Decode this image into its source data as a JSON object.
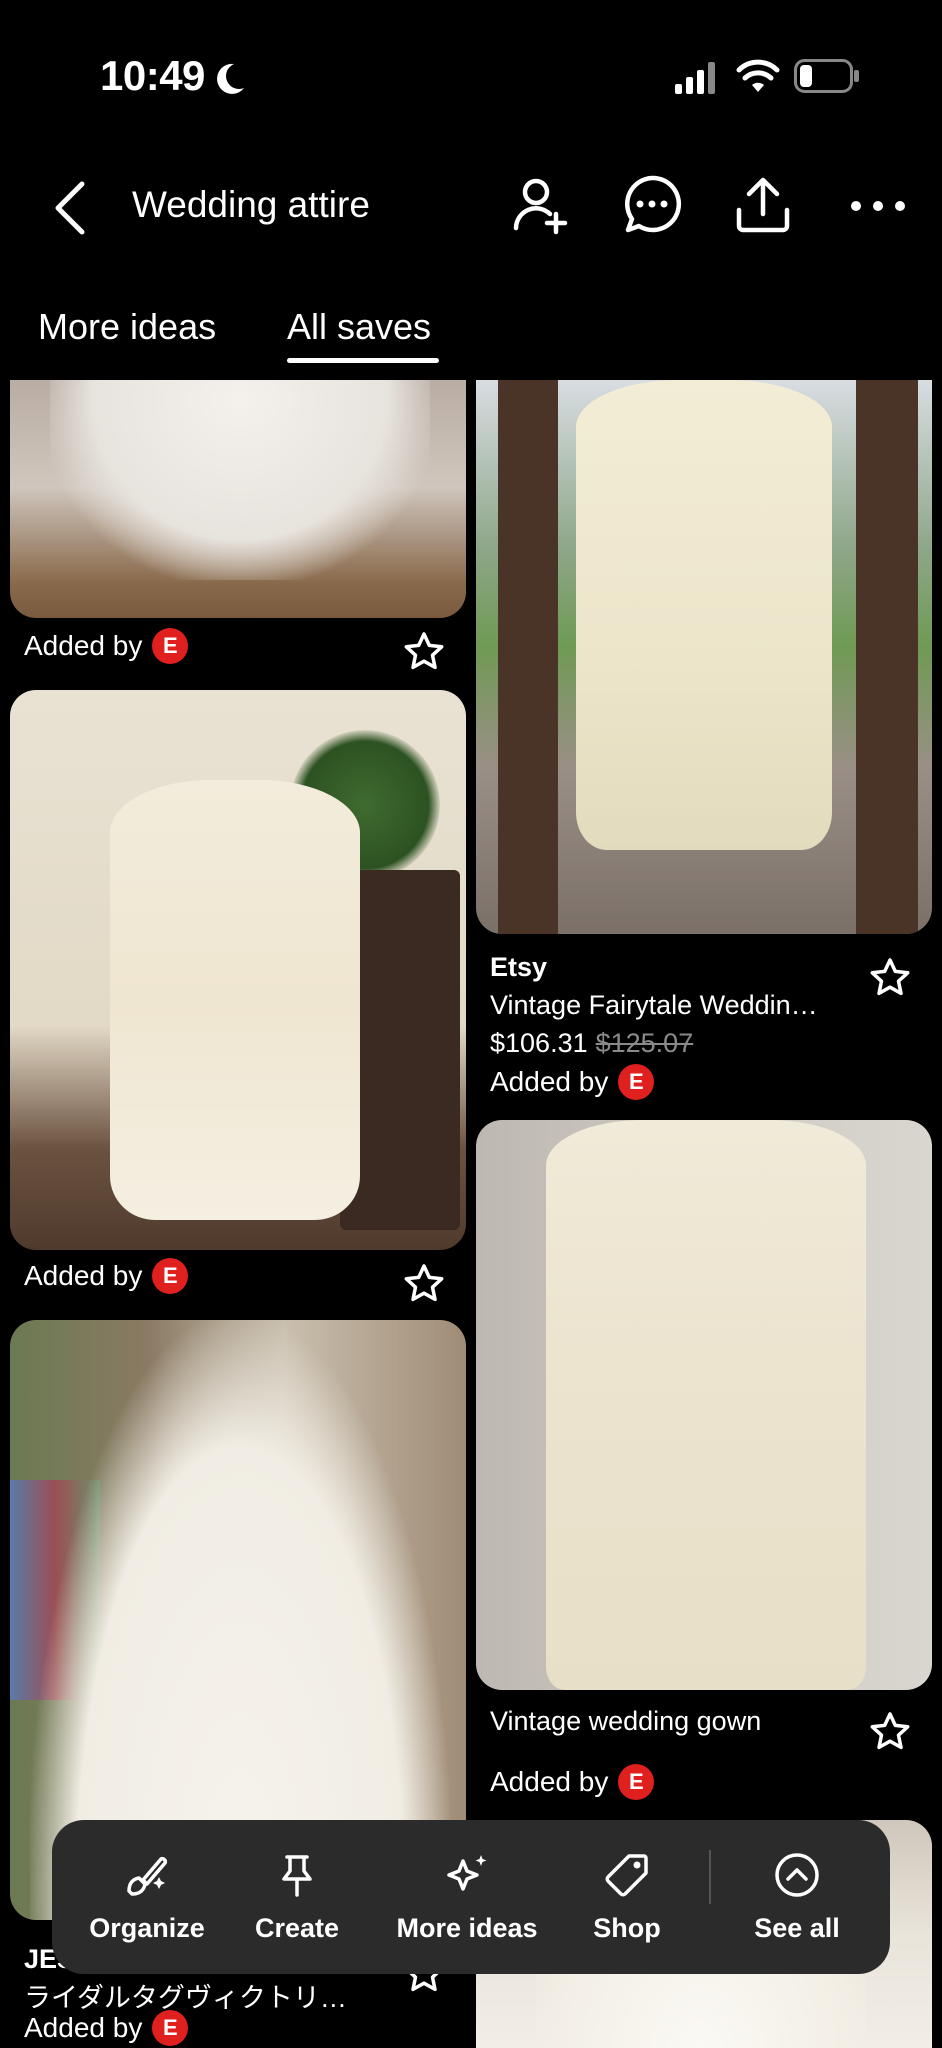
{
  "status_bar": {
    "time": "10:49"
  },
  "header": {
    "title": "Wedding attire"
  },
  "tabs": [
    {
      "label": "More ideas",
      "active": false
    },
    {
      "label": "All saves",
      "active": true
    }
  ],
  "pins": {
    "p1": {
      "added_by": "Added by",
      "badge": "E"
    },
    "p2": {
      "source": "Etsy",
      "title": "Vintage Fairytale Weddin…",
      "price": "$106.31",
      "old_price": "$125.07",
      "added_by": "Added by",
      "badge": "E"
    },
    "p3": {
      "added_by": "Added by",
      "badge": "E"
    },
    "p4": {
      "title": "Vintage wedding gown",
      "added_by": "Added by",
      "badge": "E"
    },
    "p5": {
      "source": "JES",
      "title": "ライダルタグヴィクトリ…",
      "added_by": "Added by",
      "badge": "E"
    }
  },
  "toolbar": {
    "items": [
      {
        "label": "Organize",
        "icon": "organize-brush-icon"
      },
      {
        "label": "Create",
        "icon": "pin-icon"
      },
      {
        "label": "More ideas",
        "icon": "sparkle-icon"
      },
      {
        "label": "Shop",
        "icon": "tag-icon"
      },
      {
        "label": "See all",
        "icon": "chevron-up-circle-icon"
      }
    ]
  },
  "colors": {
    "background": "#000000",
    "badge": "#e01f1f",
    "toolbar": "#2b2b2b"
  }
}
